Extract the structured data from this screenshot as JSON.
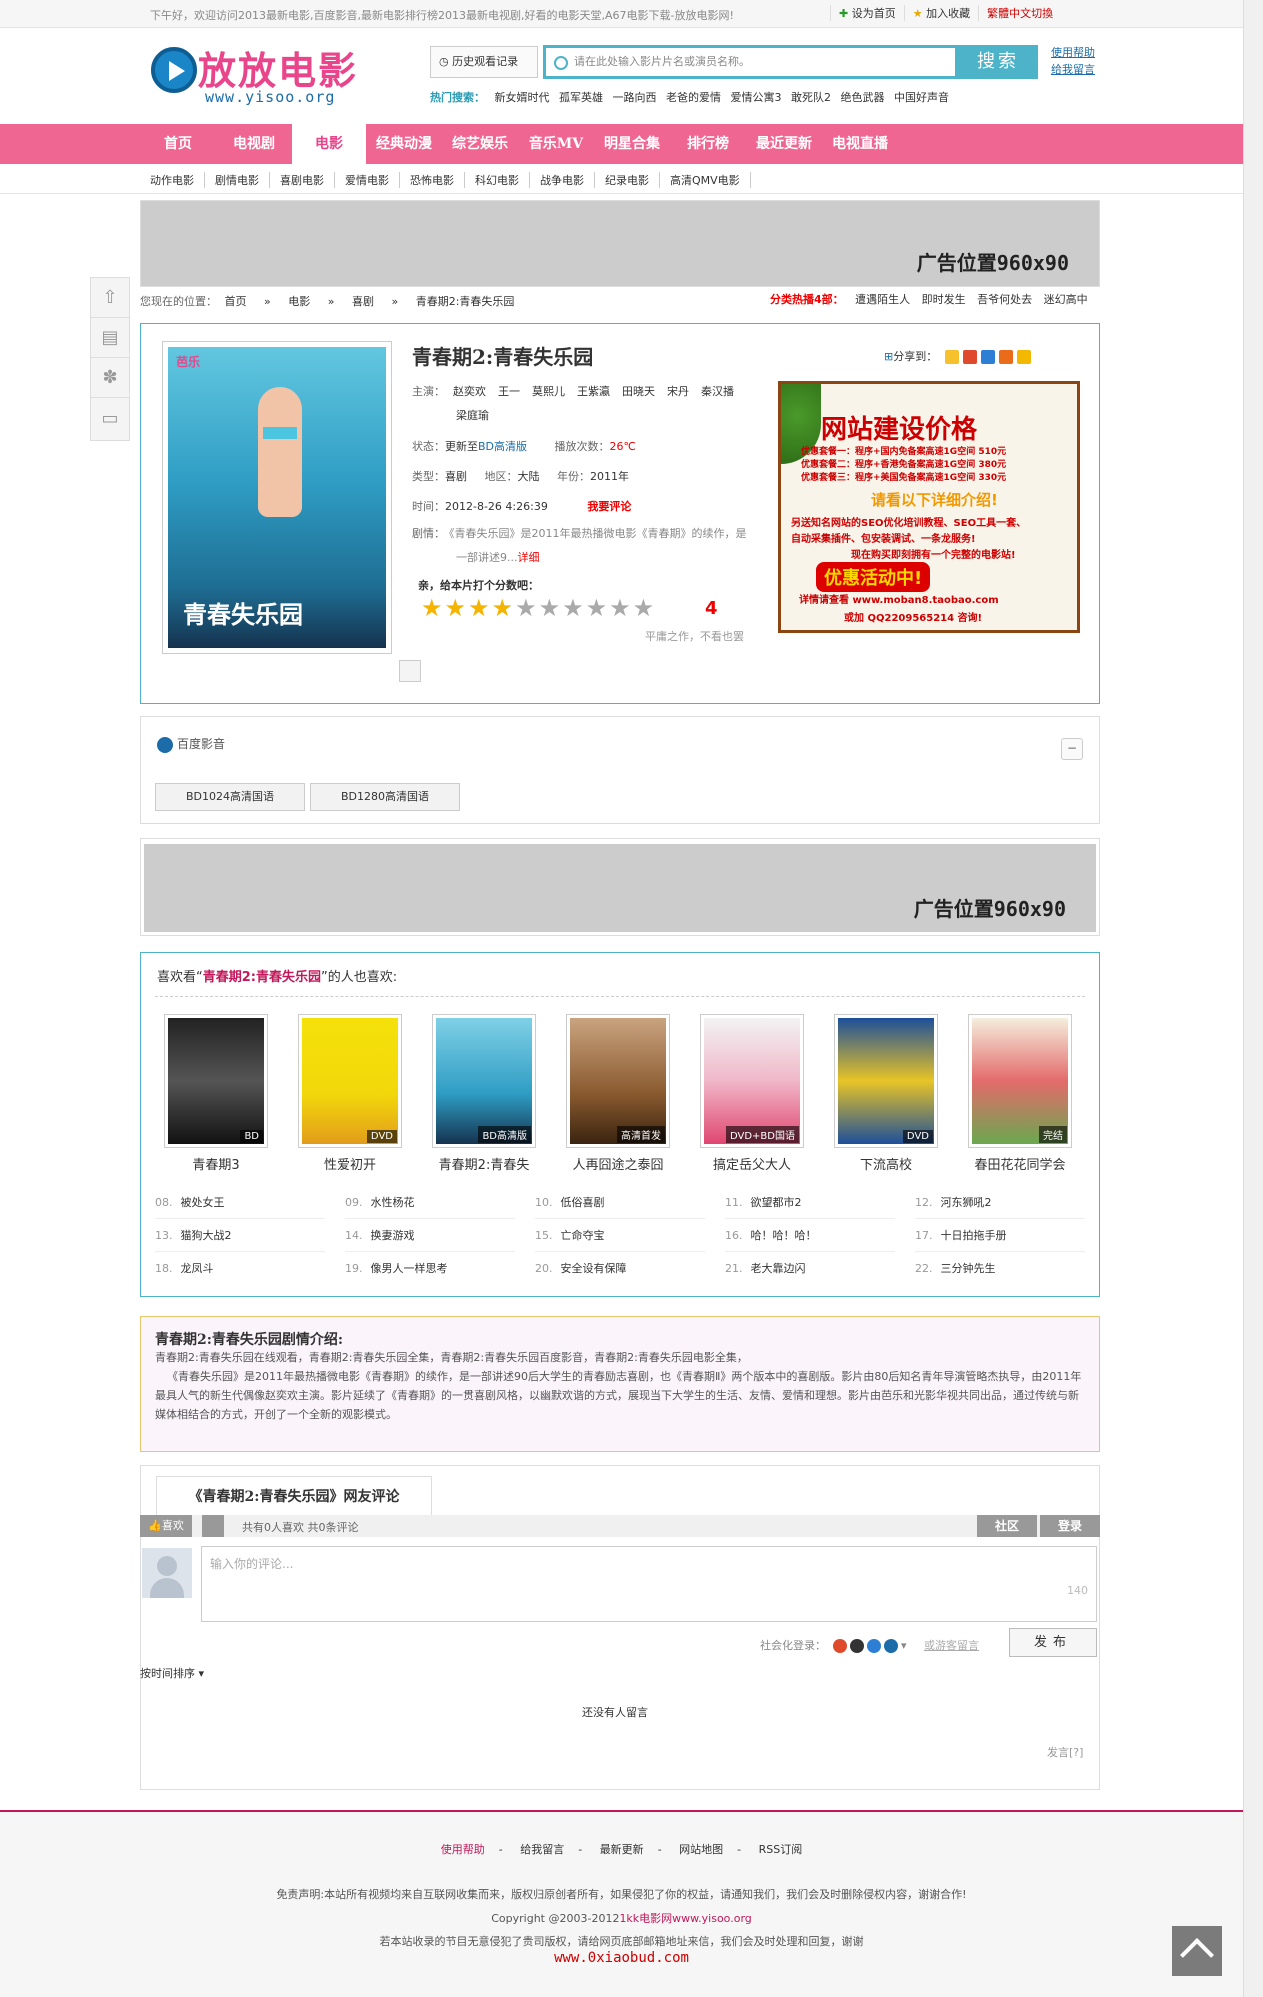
{
  "topbar": {
    "welcome": "下午好，欢迎访问2013最新电影,百度影音,最新电影排行榜2013最新电视剧,好看的电影天堂,A67电影下载-放放电影网!",
    "set_home": "设为首页",
    "add_fav": "加入收藏",
    "lang": "繁體中文切換"
  },
  "header": {
    "logo_cn": "放放电影",
    "logo_en": "www.yisoo.org",
    "history": "历史观看记录",
    "search_placeholder": "请在此处输入影片片名或演员名称。",
    "search_btn": "搜索",
    "help": "使用帮助",
    "msg": "给我留言",
    "hot_label": "热门搜索：",
    "hot": [
      "新女婿时代",
      "孤军英雄",
      "一路向西",
      "老爸的爱情",
      "爱情公寓3",
      "敢死队2",
      "绝色武器",
      "中国好声音"
    ]
  },
  "nav": [
    "首页",
    "电视剧",
    "电影",
    "经典动漫",
    "综艺娱乐",
    "音乐MV",
    "明星合集",
    "排行榜",
    "最近更新",
    "电视直播"
  ],
  "nav_active": "电影",
  "subnav": [
    "动作电影",
    "剧情电影",
    "喜剧电影",
    "爱情电影",
    "恐怖电影",
    "科幻电影",
    "战争电影",
    "纪录电影",
    "高清QMV电影"
  ],
  "ad_label": "广告位置960x90",
  "breadcrumb": {
    "prefix": "您现在的位置：",
    "home": "首页",
    "sep": "»",
    "c1": "电影",
    "c2": "喜剧",
    "current": "青春期2:青春失乐园"
  },
  "hotcat": {
    "label": "分类热播4部：",
    "items": [
      "遭遇陌生人",
      "即时发生",
      "吾爷何处去",
      "迷幻高中"
    ]
  },
  "movie": {
    "title": "青春期2:青春失乐园",
    "share": "分享到：",
    "poster_title": "青春失乐园",
    "poster_brand": "芭乐",
    "actors_label": "主演：",
    "actors": [
      "赵奕欢",
      "王一",
      "莫熙儿",
      "王紫瀛",
      "田晓天",
      "宋丹",
      "秦汉播",
      "梁庭瑜"
    ],
    "status_label": "状态：",
    "status": "更新至",
    "status_val": "BD高清版",
    "plays_label": "播放次数：",
    "plays": "26℃",
    "type_label": "类型：",
    "type": "喜剧",
    "region_label": "地区：",
    "region": "大陆",
    "year_label": "年份：",
    "year": "2011年",
    "time_label": "时间：",
    "time": "2012-8-26 4:26:39",
    "comment_link": "我要评论",
    "plot_label": "剧情：",
    "plot_short": "《青春失乐园》是2011年最热播微电影《青春期》的续作，是一部讲述9...",
    "detail_link": "详细",
    "rate_prompt": "亲，给本片打个分数吧：",
    "score": "4",
    "score_text": "平庸之作，不看也罢"
  },
  "sidead": {
    "h1": "网站建设价格",
    "l1": "优惠套餐一：程序+国内免备案高速1G空间 510元",
    "l2": "优惠套餐二：程序+香港免备案高速1G空间 380元",
    "l3": "优惠套餐三：程序+美国免备案高速1G空间 330元",
    "h2": "请看以下详细介绍!",
    "l4": "另送知名网站的SEO优化培训教程、SEO工具一套、",
    "l5": "自动采集插件、包安装调试、一条龙服务!",
    "l6": "现在购买即刻拥有一个完整的电影站!",
    "act": "优惠活动中!",
    "b1": "详情请查看 www.moban8.taobao.com",
    "b2": "或加 QQ2209565214 咨询!"
  },
  "player": {
    "brand": "百度影音",
    "collapse": "−",
    "sources": [
      "BD1024高清国语",
      "BD1280高清国语"
    ]
  },
  "related": {
    "prefix": "喜欢看“",
    "movie": "青春期2:青春失乐园",
    "suffix": "”的人也喜欢:",
    "items": [
      {
        "name": "青春期3",
        "tag": "BD"
      },
      {
        "name": "性爱初开",
        "tag": "DVD"
      },
      {
        "name": "青春期2:青春失",
        "tag": "BD高清版"
      },
      {
        "name": "人再囧途之泰囧",
        "tag": "高清首发"
      },
      {
        "name": "搞定岳父大人",
        "tag": "DVD+BD国语"
      },
      {
        "name": "下流高校",
        "tag": "DVD"
      },
      {
        "name": "春田花花同学会",
        "tag": "完结"
      }
    ],
    "list": [
      {
        "n": "08.",
        "t": "被处女王"
      },
      {
        "n": "09.",
        "t": "水性杨花"
      },
      {
        "n": "10.",
        "t": "低俗喜剧"
      },
      {
        "n": "11.",
        "t": "欲望都市2"
      },
      {
        "n": "12.",
        "t": "河东狮吼2"
      },
      {
        "n": "13.",
        "t": "猫狗大战2"
      },
      {
        "n": "14.",
        "t": "换妻游戏"
      },
      {
        "n": "15.",
        "t": "亡命夺宝"
      },
      {
        "n": "16.",
        "t": "哈！哈！哈！"
      },
      {
        "n": "17.",
        "t": "十日拍拖手册"
      },
      {
        "n": "18.",
        "t": "龙凤斗"
      },
      {
        "n": "19.",
        "t": "像男人一样思考"
      },
      {
        "n": "20.",
        "t": "安全设有保障"
      },
      {
        "n": "21.",
        "t": "老大靠边闪"
      },
      {
        "n": "22.",
        "t": "三分钟先生"
      }
    ]
  },
  "plot": {
    "title": "青春期2:青春失乐园剧情介绍:",
    "line1": "青春期2:青春失乐园在线观看，青春期2:青春失乐园全集，青春期2:青春失乐园百度影音，青春期2:青春失乐园电影全集，",
    "line2": "《青春失乐园》是2011年最热播微电影《青春期》的续作，是一部讲述90后大学生的青春励志喜剧，也《青春期Ⅱ》两个版本中的喜剧版。影片由80后知名青年导演管略杰执导，由2011年最具人气的新生代偶像赵奕欢主演。影片延续了《青春期》的一贯喜剧风格，以幽默欢谐的方式，展现当下大学生的生活、友情、爱情和理想。影片由芭乐和光影华视共同出品，通过传统与新媒体相结合的方式，开创了一个全新的观影模式。"
  },
  "comments": {
    "tab": "《青春期2:青春失乐园》网友评论",
    "like": "喜欢",
    "stats": "共有0人喜欢  共0条评论",
    "community": "社区",
    "login": "登录",
    "placeholder": "输入你的评论...",
    "count": "140",
    "social_login": "社会化登录：",
    "guest": "或游客留言",
    "publish": "发布",
    "sort": "按时间排序",
    "empty": "还没有人留言",
    "report": "发言[?]"
  },
  "footer": {
    "links": [
      "使用帮助",
      "给我留言",
      "最新更新",
      "网站地图",
      "RSS订阅"
    ],
    "sep": "-",
    "disclaimer": "免责声明:本站所有视频均来自互联网收集而来，版权归原创者所有，如果侵犯了你的权益，请通知我们，我们会及时删除侵权内容，谢谢合作!",
    "copyright": "Copyright @2003-2012",
    "copyright_site": "1kk电影网www.yisoo.org",
    "notice": "若本站收录的节目无意侵犯了贵司版权，请给网页底部邮箱地址来信，我们会及时处理和回复，谢谢",
    "watermark": "www.0xiaobud.com"
  }
}
